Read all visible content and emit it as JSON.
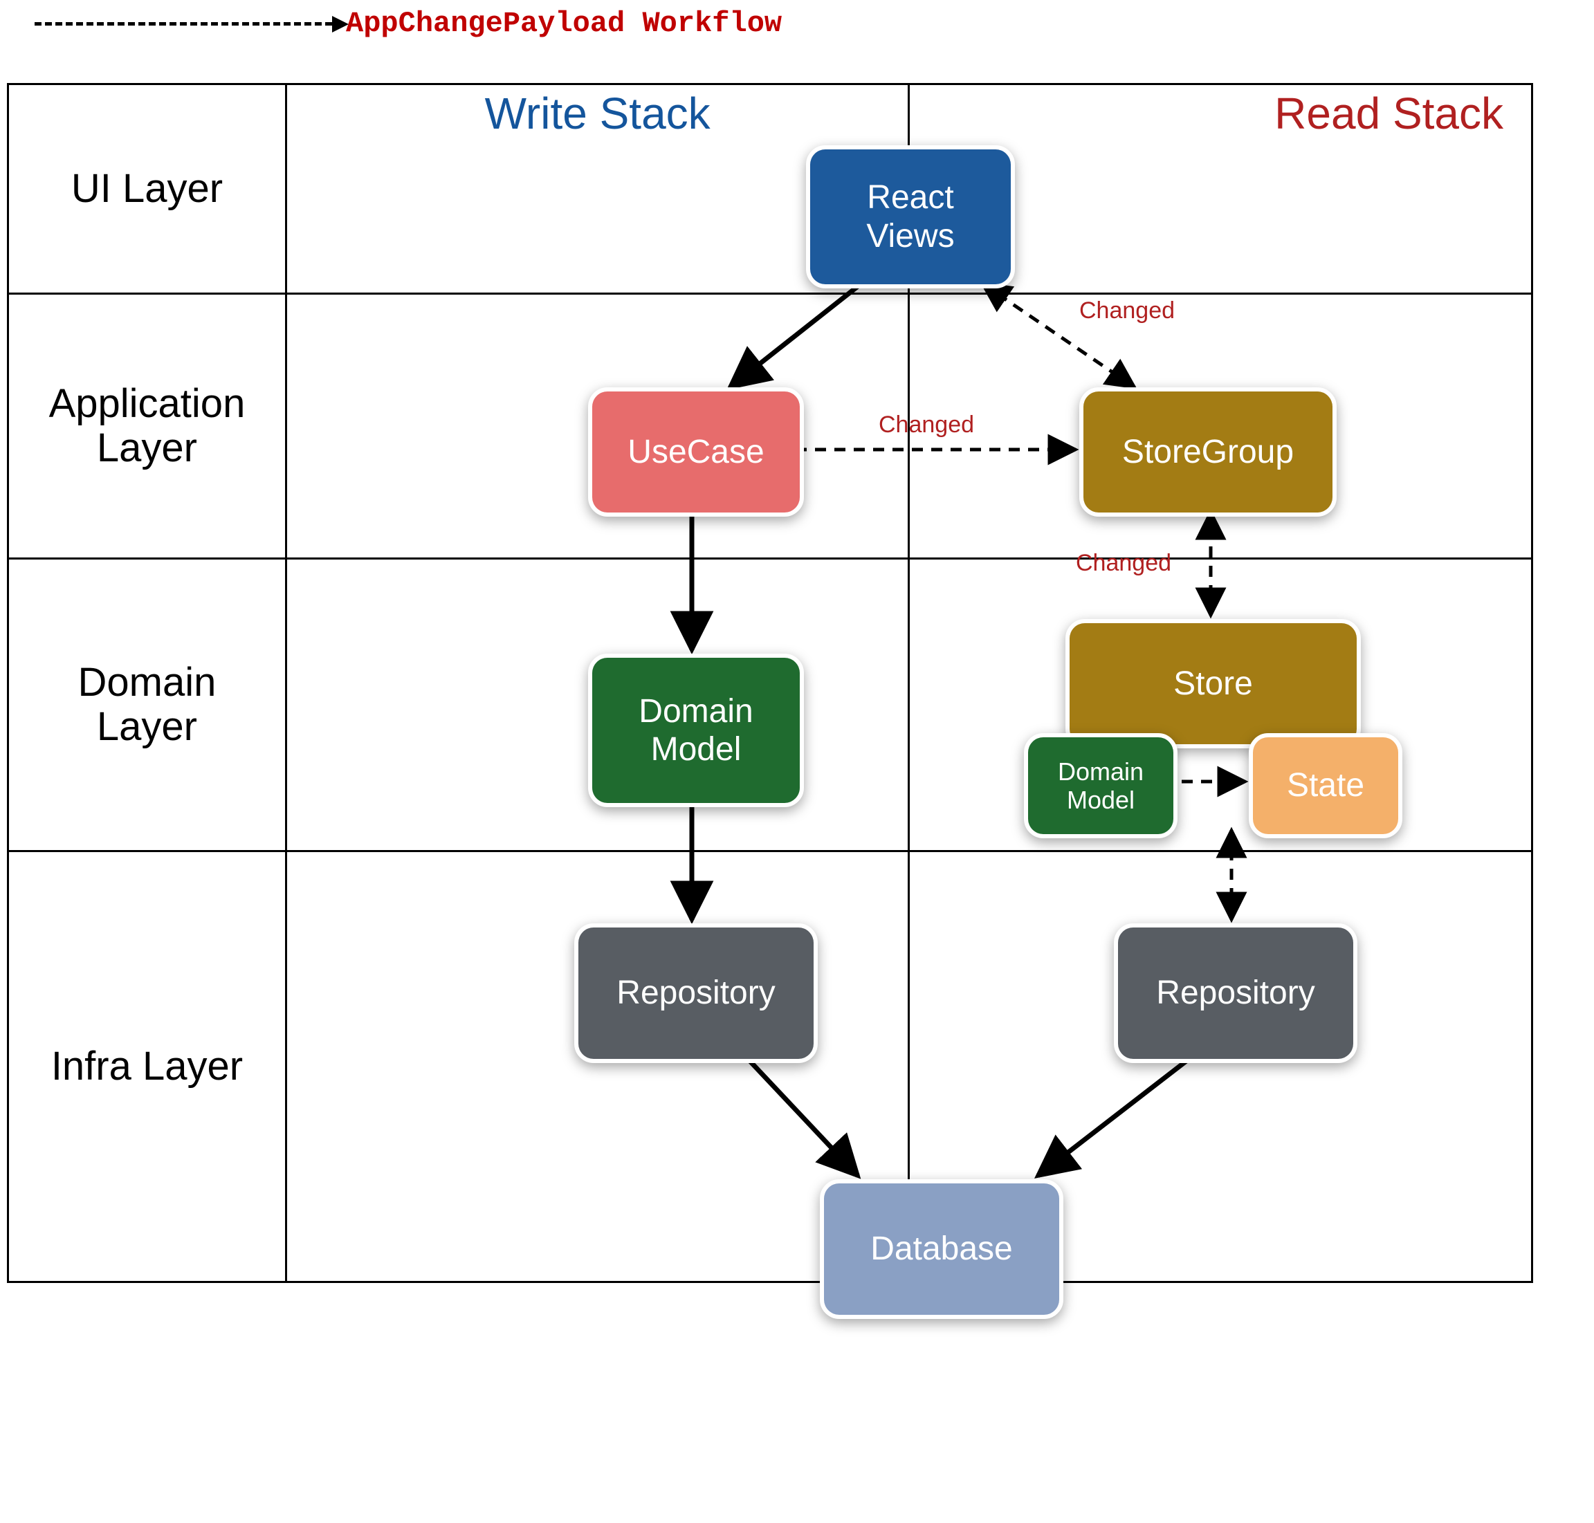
{
  "legend": {
    "label": "AppChangePayload Workflow"
  },
  "columns": {
    "write": "Write Stack",
    "read": "Read Stack"
  },
  "layers": {
    "ui": "UI Layer",
    "application": "Application\nLayer",
    "domain": "Domain\nLayer",
    "infra": "Infra Layer"
  },
  "nodes": {
    "react_views": "React\nViews",
    "usecase": "UseCase",
    "storegroup": "StoreGroup",
    "domain_model": "Domain\nModel",
    "store": "Store",
    "domain_model_small": "Domain\nModel",
    "state": "State",
    "repository_left": "Repository",
    "repository_right": "Repository",
    "database": "Database"
  },
  "edge_labels": {
    "usecase_to_storegroup": "Changed",
    "storegroup_to_views": "Changed",
    "store_to_storegroup": "Changed"
  },
  "colors": {
    "blue": "#1d5a9c",
    "red_node": "#e76c6c",
    "olive": "#a37c14",
    "green": "#1f6b2f",
    "orange": "#f4b06a",
    "grey": "#585d63",
    "slate": "#8aa0c4",
    "write_header": "#14559c",
    "read_header": "#b02020",
    "workflow_text": "#c00000"
  },
  "chart_data": {
    "type": "diagram",
    "title": "AppChangePayload Workflow",
    "columns": [
      "Write Stack",
      "Read Stack"
    ],
    "rows": [
      "UI Layer",
      "Application Layer",
      "Domain Layer",
      "Infra Layer"
    ],
    "nodes": [
      {
        "id": "react_views",
        "label": "React Views",
        "row": "UI Layer",
        "column": "center",
        "color": "blue"
      },
      {
        "id": "usecase",
        "label": "UseCase",
        "row": "Application Layer",
        "column": "Write Stack",
        "color": "red"
      },
      {
        "id": "storegroup",
        "label": "StoreGroup",
        "row": "Application Layer",
        "column": "Read Stack",
        "color": "olive"
      },
      {
        "id": "domain_model",
        "label": "Domain Model",
        "row": "Domain Layer",
        "column": "Write Stack",
        "color": "green"
      },
      {
        "id": "store",
        "label": "Store",
        "row": "Domain Layer",
        "column": "Read Stack",
        "color": "olive"
      },
      {
        "id": "domain_model_small",
        "label": "Domain Model",
        "row": "Domain Layer",
        "column": "Read Stack",
        "color": "green"
      },
      {
        "id": "state",
        "label": "State",
        "row": "Domain Layer",
        "column": "Read Stack",
        "color": "orange"
      },
      {
        "id": "repository_left",
        "label": "Repository",
        "row": "Infra Layer",
        "column": "Write Stack",
        "color": "grey"
      },
      {
        "id": "repository_right",
        "label": "Repository",
        "row": "Infra Layer",
        "column": "Read Stack",
        "color": "grey"
      },
      {
        "id": "database",
        "label": "Database",
        "row": "Infra Layer",
        "column": "center",
        "color": "slate"
      }
    ],
    "edges": [
      {
        "from": "react_views",
        "to": "usecase",
        "style": "solid",
        "direction": "forward"
      },
      {
        "from": "usecase",
        "to": "domain_model",
        "style": "solid",
        "direction": "forward"
      },
      {
        "from": "domain_model",
        "to": "repository_left",
        "style": "solid",
        "direction": "forward"
      },
      {
        "from": "repository_left",
        "to": "database",
        "style": "solid",
        "direction": "forward"
      },
      {
        "from": "repository_right",
        "to": "database",
        "style": "solid",
        "direction": "forward"
      },
      {
        "from": "usecase",
        "to": "storegroup",
        "style": "dashed",
        "direction": "forward",
        "label": "Changed"
      },
      {
        "from": "storegroup",
        "to": "react_views",
        "style": "dashed",
        "direction": "both",
        "label": "Changed"
      },
      {
        "from": "store",
        "to": "storegroup",
        "style": "dashed",
        "direction": "both",
        "label": "Changed"
      },
      {
        "from": "domain_model_small",
        "to": "state",
        "style": "dashed",
        "direction": "forward"
      },
      {
        "from": "store",
        "to": "repository_right",
        "style": "dashed",
        "direction": "both"
      }
    ]
  }
}
